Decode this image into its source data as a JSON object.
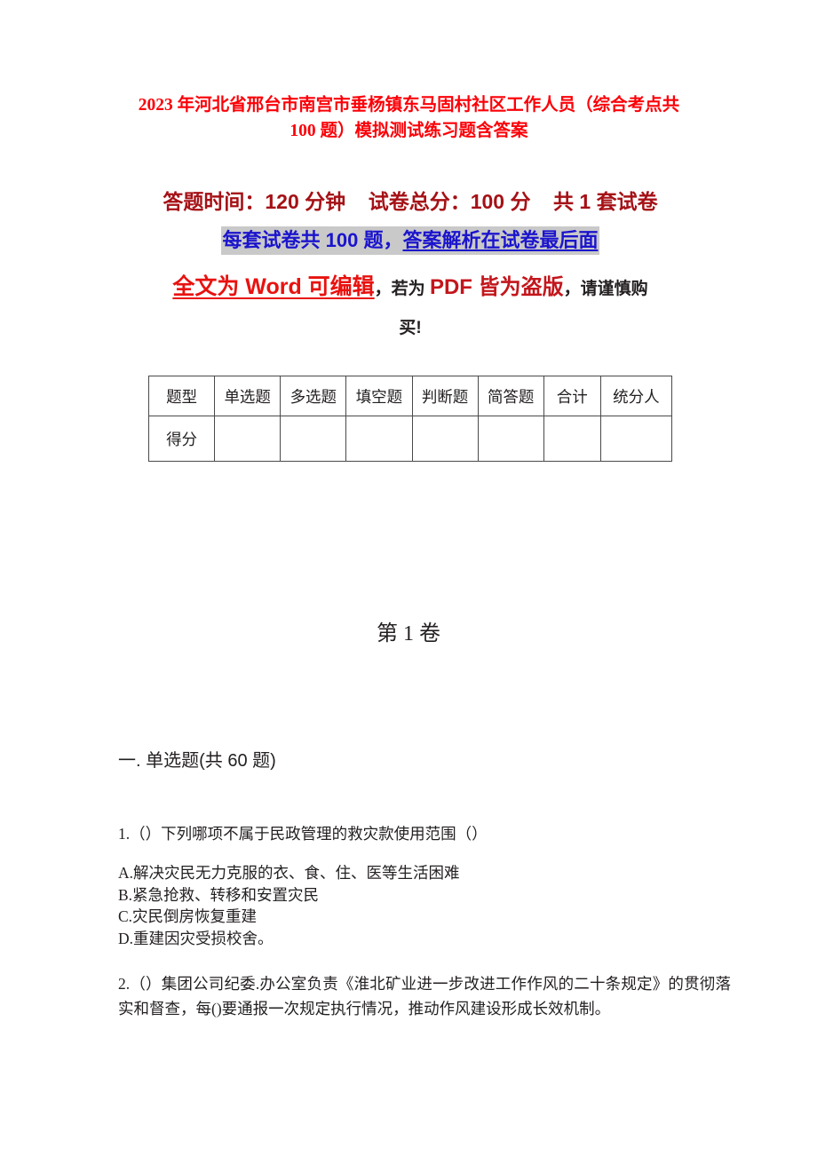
{
  "document": {
    "title": "2023 年河北省邢台市南宫市垂杨镇东马固村社区工作人员（综合考点共 100 题）模拟测试练习题含答案",
    "colors": {
      "title_red": "#fb0007",
      "banner_crimson": "#a51116",
      "banner_blue": "#1b14cd",
      "banner_highlight_gray": "#c9c9c9",
      "bright_red": "#e8120f",
      "dark_text": "#231f20",
      "table_border": "#494949"
    }
  },
  "banner": {
    "line1": "答题时间：120 分钟    试卷总分：100 分    共 1 套试卷",
    "line2_plain": "每套试卷共 100 题，",
    "line2_underlined": "答案解析在试卷最后面",
    "line3_seg1": "全文为 Word 可编辑",
    "line3_seg2": "，若为 ",
    "line3_seg3": "PDF 皆为盗版",
    "line3_seg4": "，请谨慎购",
    "line4": "买!"
  },
  "score_table": {
    "headers": [
      "题型",
      "单选题",
      "多选题",
      "填空题",
      "判断题",
      "简答题",
      "合计",
      "统分人"
    ],
    "rows": [
      {
        "label": "得分",
        "values": [
          "",
          "",
          "",
          "",
          "",
          "",
          ""
        ]
      }
    ]
  },
  "volume": {
    "heading": "第 1 卷"
  },
  "sections": [
    {
      "heading": "一. 单选题(共 60 题)",
      "questions": [
        {
          "stem": "1.（）下列哪项不属于民政管理的救灾款使用范围（）",
          "options": [
            "A.解决灾民无力克服的衣、食、住、医等生活困难",
            "B.紧急抢救、转移和安置灾民",
            "C.灾民倒房恢复重建",
            "D.重建因灾受损校舍。"
          ]
        },
        {
          "stem": "2.（）集团公司纪委.办公室负责《淮北矿业进一步改进工作作风的二十条规定》的贯彻落实和督查，每()要通报一次规定执行情况，推动作风建设形成长效机制。",
          "options": []
        }
      ]
    }
  ]
}
